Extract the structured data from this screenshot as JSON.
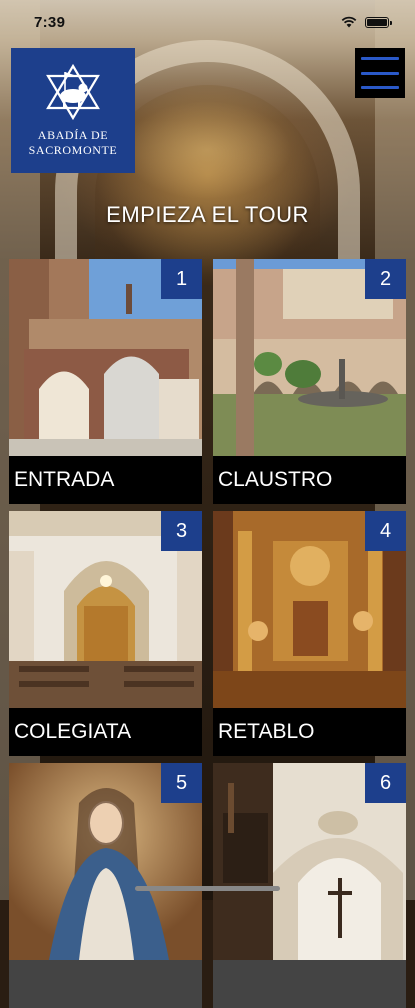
{
  "status": {
    "time": "7:39"
  },
  "logo": {
    "line1": "ABADÍA DE",
    "line2": "SACROMONTE"
  },
  "header": {
    "title": "EMPIEZA EL TOUR"
  },
  "colors": {
    "brand_blue": "#1d3f8c",
    "menu_bar": "#2a59c9"
  },
  "icons": {
    "menu": "hamburger-menu-icon",
    "wifi": "wifi-icon",
    "battery": "battery-icon",
    "logo": "lamb-cross-emblem-icon"
  },
  "tour": [
    {
      "number": "1",
      "label": "ENTRADA"
    },
    {
      "number": "2",
      "label": "CLAUSTRO"
    },
    {
      "number": "3",
      "label": "COLEGIATA"
    },
    {
      "number": "4",
      "label": "RETABLO"
    },
    {
      "number": "5",
      "label": ""
    },
    {
      "number": "6",
      "label": ""
    }
  ]
}
